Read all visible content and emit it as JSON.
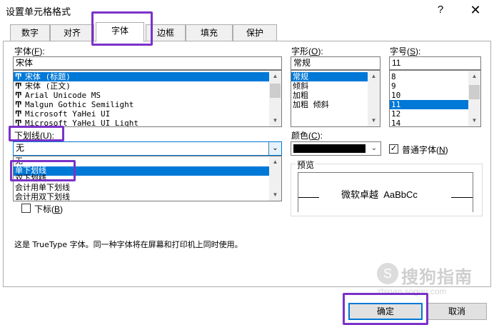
{
  "window": {
    "title": "设置单元格格式",
    "help_glyph": "?",
    "close_glyph": "✕"
  },
  "tabs": [
    "数字",
    "对齐",
    "字体",
    "边框",
    "填充",
    "保护"
  ],
  "font": {
    "label": "字体(F):",
    "label_pre": "字体(",
    "label_key": "F",
    "label_post": "):",
    "value": "宋体",
    "items": [
      "宋体 (标题)",
      "宋体 (正文)",
      "Arial Unicode MS",
      "Malgun Gothic Semilight",
      "Microsoft YaHei UI",
      "Microsoft YaHei UI Light"
    ],
    "font_icon": "font-tt-icon",
    "tt_glyph": "Ͳ"
  },
  "style": {
    "label": "字形(O):",
    "label_pre": "字形(",
    "label_key": "O",
    "label_post": "):",
    "value": "常规",
    "items": [
      "常规",
      "倾斜",
      "加粗",
      "加粗 倾斜"
    ]
  },
  "size": {
    "label": "字号(S):",
    "label_pre": "字号(",
    "label_key": "S",
    "label_post": "):",
    "value": "11",
    "items": [
      "8",
      "9",
      "10",
      "11",
      "12",
      "14"
    ]
  },
  "underline": {
    "label": "下划线(U):",
    "label_pre": "下划线(",
    "label_key": "U",
    "label_post": "):",
    "value": "无",
    "items": [
      "无",
      "单下划线",
      "双下划线",
      "会计用单下划线",
      "会计用双下划线"
    ]
  },
  "color": {
    "label": "颜色(C):",
    "label_pre": "颜色(",
    "label_key": "C",
    "label_post": "):",
    "swatch": "#000000"
  },
  "normal_font": {
    "label_pre": "普通字体(",
    "label_key": "N",
    "label_post": ")",
    "checked": true
  },
  "subscript": {
    "label_pre": "下标(",
    "label_key": "B",
    "label_post": ")",
    "checked": false
  },
  "preview": {
    "legend": "预览",
    "sample": "微软卓越  AaBbCc"
  },
  "info_text": "这是 TrueType 字体。同一种字体将在屏幕和打印机上同时使用。",
  "buttons": {
    "ok": "确定",
    "cancel": "取消"
  },
  "watermark": {
    "text": "搜狗指南",
    "sub": "zhinan.sogou.com"
  },
  "colors": {
    "selection": "#0078d7",
    "highlight": "#7b32c8",
    "button_bg": "#e1e1e1"
  }
}
